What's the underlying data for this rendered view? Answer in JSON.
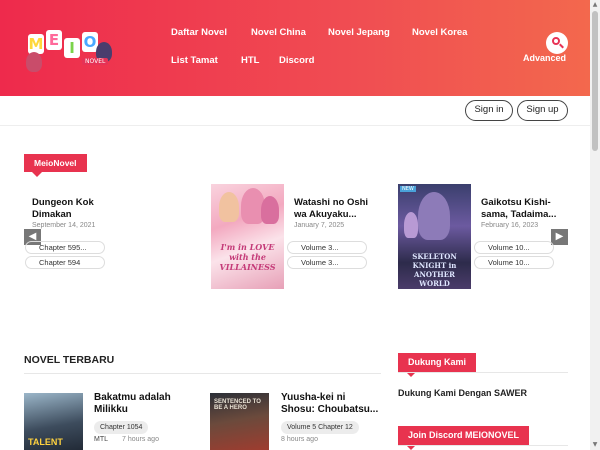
{
  "header": {
    "logo_text": [
      "M",
      "E",
      "I",
      "O"
    ],
    "logo_tag": "NOVEL",
    "nav": [
      {
        "label": "Daftar Novel"
      },
      {
        "label": "Novel China"
      },
      {
        "label": "Novel Jepang"
      },
      {
        "label": "Novel Korea"
      },
      {
        "label": "List Tamat"
      },
      {
        "label": "HTL"
      },
      {
        "label": "Discord"
      }
    ],
    "search_icon": "search-icon",
    "advanced_label": "Advanced",
    "accent_color": "#ee2a4c"
  },
  "auth": {
    "signin_label": "Sign in",
    "signup_label": "Sign up"
  },
  "featured": {
    "section_label": "MeioNovel",
    "prev_icon": "chevron-left-icon",
    "next_icon": "chevron-right-icon",
    "prev_glyph": "◀",
    "next_glyph": "▶",
    "cards": [
      {
        "title": "Dungeon Kok Dimakan",
        "date": "September 14, 2021",
        "chapters": [
          "Chapter 595...",
          "Chapter 594"
        ]
      },
      {
        "title": "Watashi no Oshi wa Akuyaku...",
        "date": "January 7, 2025",
        "cover_text": "I'm in LOVE with the VILLAINESS",
        "chapters": [
          "Volume 3...",
          "Volume 3..."
        ]
      },
      {
        "title": "Gaikotsu Kishi-sama, Tadaima...",
        "date": "February 16, 2023",
        "cover_text": "SKELETON KNIGHT in ANOTHER WORLD",
        "cover_badge": "NEW",
        "chapters": [
          "Volume 10...",
          "Volume 10..."
        ]
      }
    ]
  },
  "latest": {
    "section_label": "NOVEL TERBARU",
    "items": [
      {
        "title": "Bakatmu adalah Milikku",
        "chapter": "Chapter 1054",
        "type": "MTL",
        "time": "7 hours ago",
        "cover_text": "TALENT"
      },
      {
        "title": "Yuusha-kei ni Shosu: Choubatsu...",
        "chapter": "Volume 5 Chapter 12",
        "type": "",
        "time": "8 hours ago",
        "cover_text": "SENTENCED TO BE A HERO"
      }
    ]
  },
  "sidebar": {
    "support_label": "Dukung Kami",
    "support_text": "Dukung Kami Dengan SAWER",
    "discord_label": "Join Discord MEIONOVEL"
  },
  "scrollbar": {
    "up_glyph": "▲",
    "down_glyph": "▼"
  }
}
